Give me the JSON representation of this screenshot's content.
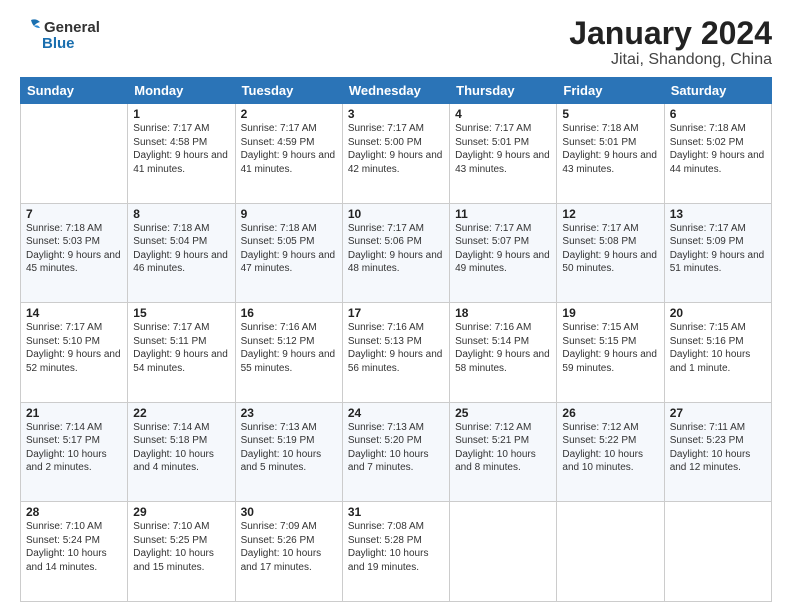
{
  "header": {
    "logo_line1": "General",
    "logo_line2": "Blue",
    "title": "January 2024",
    "subtitle": "Jitai, Shandong, China"
  },
  "days_of_week": [
    "Sunday",
    "Monday",
    "Tuesday",
    "Wednesday",
    "Thursday",
    "Friday",
    "Saturday"
  ],
  "weeks": [
    [
      {
        "day": "",
        "sunrise": "",
        "sunset": "",
        "daylight": ""
      },
      {
        "day": "1",
        "sunrise": "Sunrise: 7:17 AM",
        "sunset": "Sunset: 4:58 PM",
        "daylight": "Daylight: 9 hours and 41 minutes."
      },
      {
        "day": "2",
        "sunrise": "Sunrise: 7:17 AM",
        "sunset": "Sunset: 4:59 PM",
        "daylight": "Daylight: 9 hours and 41 minutes."
      },
      {
        "day": "3",
        "sunrise": "Sunrise: 7:17 AM",
        "sunset": "Sunset: 5:00 PM",
        "daylight": "Daylight: 9 hours and 42 minutes."
      },
      {
        "day": "4",
        "sunrise": "Sunrise: 7:17 AM",
        "sunset": "Sunset: 5:01 PM",
        "daylight": "Daylight: 9 hours and 43 minutes."
      },
      {
        "day": "5",
        "sunrise": "Sunrise: 7:18 AM",
        "sunset": "Sunset: 5:01 PM",
        "daylight": "Daylight: 9 hours and 43 minutes."
      },
      {
        "day": "6",
        "sunrise": "Sunrise: 7:18 AM",
        "sunset": "Sunset: 5:02 PM",
        "daylight": "Daylight: 9 hours and 44 minutes."
      }
    ],
    [
      {
        "day": "7",
        "sunrise": "Sunrise: 7:18 AM",
        "sunset": "Sunset: 5:03 PM",
        "daylight": "Daylight: 9 hours and 45 minutes."
      },
      {
        "day": "8",
        "sunrise": "Sunrise: 7:18 AM",
        "sunset": "Sunset: 5:04 PM",
        "daylight": "Daylight: 9 hours and 46 minutes."
      },
      {
        "day": "9",
        "sunrise": "Sunrise: 7:18 AM",
        "sunset": "Sunset: 5:05 PM",
        "daylight": "Daylight: 9 hours and 47 minutes."
      },
      {
        "day": "10",
        "sunrise": "Sunrise: 7:17 AM",
        "sunset": "Sunset: 5:06 PM",
        "daylight": "Daylight: 9 hours and 48 minutes."
      },
      {
        "day": "11",
        "sunrise": "Sunrise: 7:17 AM",
        "sunset": "Sunset: 5:07 PM",
        "daylight": "Daylight: 9 hours and 49 minutes."
      },
      {
        "day": "12",
        "sunrise": "Sunrise: 7:17 AM",
        "sunset": "Sunset: 5:08 PM",
        "daylight": "Daylight: 9 hours and 50 minutes."
      },
      {
        "day": "13",
        "sunrise": "Sunrise: 7:17 AM",
        "sunset": "Sunset: 5:09 PM",
        "daylight": "Daylight: 9 hours and 51 minutes."
      }
    ],
    [
      {
        "day": "14",
        "sunrise": "Sunrise: 7:17 AM",
        "sunset": "Sunset: 5:10 PM",
        "daylight": "Daylight: 9 hours and 52 minutes."
      },
      {
        "day": "15",
        "sunrise": "Sunrise: 7:17 AM",
        "sunset": "Sunset: 5:11 PM",
        "daylight": "Daylight: 9 hours and 54 minutes."
      },
      {
        "day": "16",
        "sunrise": "Sunrise: 7:16 AM",
        "sunset": "Sunset: 5:12 PM",
        "daylight": "Daylight: 9 hours and 55 minutes."
      },
      {
        "day": "17",
        "sunrise": "Sunrise: 7:16 AM",
        "sunset": "Sunset: 5:13 PM",
        "daylight": "Daylight: 9 hours and 56 minutes."
      },
      {
        "day": "18",
        "sunrise": "Sunrise: 7:16 AM",
        "sunset": "Sunset: 5:14 PM",
        "daylight": "Daylight: 9 hours and 58 minutes."
      },
      {
        "day": "19",
        "sunrise": "Sunrise: 7:15 AM",
        "sunset": "Sunset: 5:15 PM",
        "daylight": "Daylight: 9 hours and 59 minutes."
      },
      {
        "day": "20",
        "sunrise": "Sunrise: 7:15 AM",
        "sunset": "Sunset: 5:16 PM",
        "daylight": "Daylight: 10 hours and 1 minute."
      }
    ],
    [
      {
        "day": "21",
        "sunrise": "Sunrise: 7:14 AM",
        "sunset": "Sunset: 5:17 PM",
        "daylight": "Daylight: 10 hours and 2 minutes."
      },
      {
        "day": "22",
        "sunrise": "Sunrise: 7:14 AM",
        "sunset": "Sunset: 5:18 PM",
        "daylight": "Daylight: 10 hours and 4 minutes."
      },
      {
        "day": "23",
        "sunrise": "Sunrise: 7:13 AM",
        "sunset": "Sunset: 5:19 PM",
        "daylight": "Daylight: 10 hours and 5 minutes."
      },
      {
        "day": "24",
        "sunrise": "Sunrise: 7:13 AM",
        "sunset": "Sunset: 5:20 PM",
        "daylight": "Daylight: 10 hours and 7 minutes."
      },
      {
        "day": "25",
        "sunrise": "Sunrise: 7:12 AM",
        "sunset": "Sunset: 5:21 PM",
        "daylight": "Daylight: 10 hours and 8 minutes."
      },
      {
        "day": "26",
        "sunrise": "Sunrise: 7:12 AM",
        "sunset": "Sunset: 5:22 PM",
        "daylight": "Daylight: 10 hours and 10 minutes."
      },
      {
        "day": "27",
        "sunrise": "Sunrise: 7:11 AM",
        "sunset": "Sunset: 5:23 PM",
        "daylight": "Daylight: 10 hours and 12 minutes."
      }
    ],
    [
      {
        "day": "28",
        "sunrise": "Sunrise: 7:10 AM",
        "sunset": "Sunset: 5:24 PM",
        "daylight": "Daylight: 10 hours and 14 minutes."
      },
      {
        "day": "29",
        "sunrise": "Sunrise: 7:10 AM",
        "sunset": "Sunset: 5:25 PM",
        "daylight": "Daylight: 10 hours and 15 minutes."
      },
      {
        "day": "30",
        "sunrise": "Sunrise: 7:09 AM",
        "sunset": "Sunset: 5:26 PM",
        "daylight": "Daylight: 10 hours and 17 minutes."
      },
      {
        "day": "31",
        "sunrise": "Sunrise: 7:08 AM",
        "sunset": "Sunset: 5:28 PM",
        "daylight": "Daylight: 10 hours and 19 minutes."
      },
      {
        "day": "",
        "sunrise": "",
        "sunset": "",
        "daylight": ""
      },
      {
        "day": "",
        "sunrise": "",
        "sunset": "",
        "daylight": ""
      },
      {
        "day": "",
        "sunrise": "",
        "sunset": "",
        "daylight": ""
      }
    ]
  ]
}
